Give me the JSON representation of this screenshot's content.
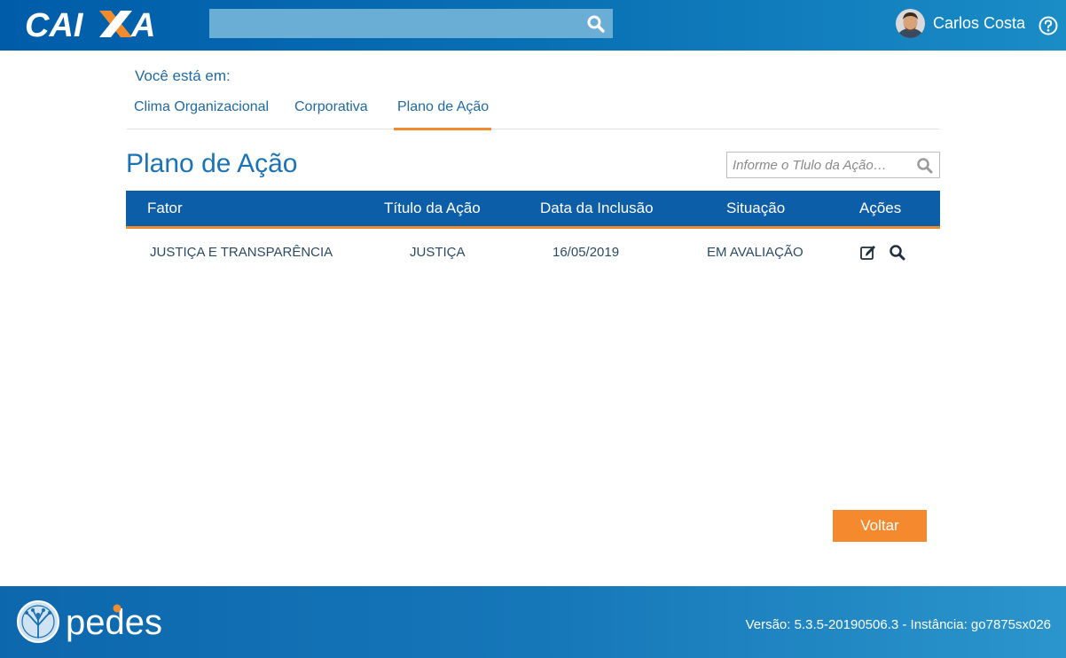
{
  "header": {
    "brand": "CAIXA",
    "search_value": "",
    "user_name": "Carlos Costa",
    "search_icon": "search-icon",
    "help_icon": "help-circle-icon"
  },
  "breadcrumb": {
    "prefix": "Você está em:",
    "tabs": [
      {
        "label": "Clima Organizacional",
        "active": false
      },
      {
        "label": "Corporativa",
        "active": false
      },
      {
        "label": "Plano de Ação",
        "active": true
      }
    ]
  },
  "main": {
    "title": "Plano de Ação",
    "search_placeholder": "Informe o Tlulo da Ação…",
    "table": {
      "headers": [
        "Fator",
        "Título da Ação",
        "Data da Inclusão",
        "Situação",
        "Ações"
      ],
      "rows": [
        {
          "fator": "JUSTIÇA E TRANSPARÊNCIA",
          "titulo": "JUSTIÇA",
          "data": "16/05/2019",
          "situacao": "EM AVALIAÇÃO",
          "actions": [
            "edit-icon",
            "search-icon"
          ]
        }
      ]
    },
    "back_button": "Voltar"
  },
  "footer": {
    "brand": "pedes",
    "version_text": "Versão: 5.3.5-20190506.3 - Instância: go7875sx026"
  },
  "colors": {
    "primary": "#0d5ea8",
    "accent": "#f28a2e",
    "header_search": "#6aaed6"
  }
}
